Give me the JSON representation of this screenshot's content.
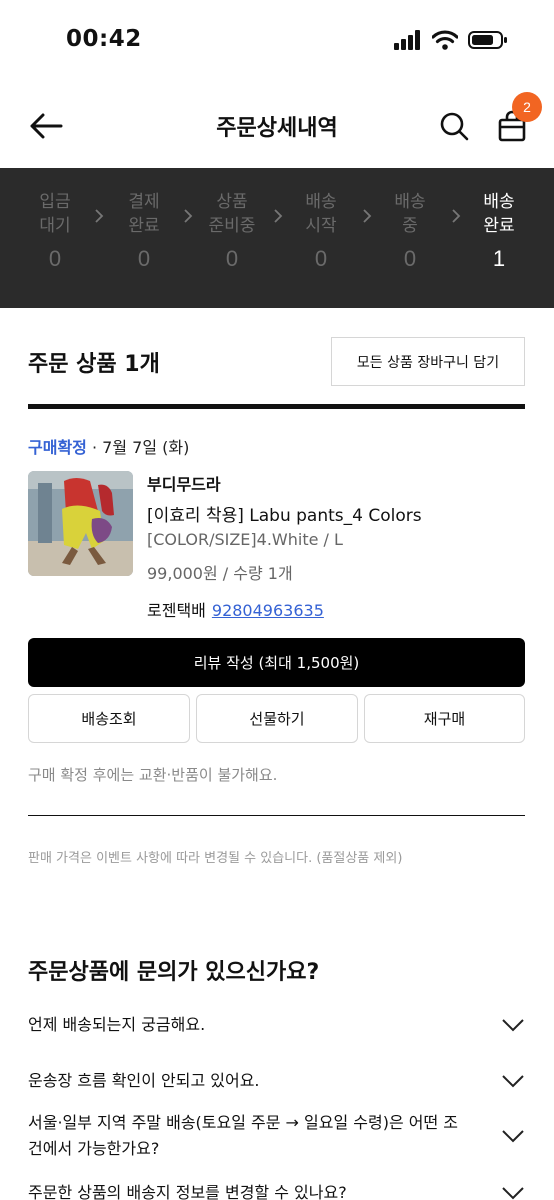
{
  "status_bar": {
    "time": "00:42"
  },
  "header": {
    "title": "주문상세내역",
    "cart_badge": "2"
  },
  "progress": {
    "steps": [
      {
        "label": "입금\n대기",
        "count": "0",
        "active": false
      },
      {
        "label": "결제\n완료",
        "count": "0",
        "active": false
      },
      {
        "label": "상품\n준비중",
        "count": "0",
        "active": false
      },
      {
        "label": "배송\n시작",
        "count": "0",
        "active": false
      },
      {
        "label": "배송\n중",
        "count": "0",
        "active": false
      },
      {
        "label": "배송\n완료",
        "count": "1",
        "active": true
      }
    ]
  },
  "order": {
    "section_title": "주문 상품 1개",
    "cart_all_label": "모든 상품 장바구니 담기",
    "status": "구매확정",
    "date": " · 7월 7일 (화)",
    "product": {
      "brand": "부디무드라",
      "name": "[이효리 착용] Labu pants_4 Colors",
      "option": "[COLOR/SIZE]4.White / L",
      "price_qty": "99,000원 / 수량 1개",
      "courier": "로젠택배",
      "tracking": "92804963635"
    },
    "review_label": "리뷰 작성 (최대 1,500원)",
    "actions": [
      "배송조회",
      "선물하기",
      "재구매"
    ],
    "note_confirm": "구매 확정 후에는 교환·반품이 불가해요.",
    "note_price": "판매 가격은 이벤트 사항에 따라 변경될 수 있습니다. (품절상품 제외)"
  },
  "faq": {
    "title": "주문상품에 문의가 있으신가요?",
    "items": [
      "언제 배송되는지 궁금해요.",
      "운송장 흐름 확인이 안되고 있어요.",
      "서울·일부 지역 주말 배송(토요일 주문 → 일요일 수령)은 어떤 조건에서 가능한가요?",
      "주문한 상품의 배송지 정보를 변경할 수 있나요?"
    ]
  },
  "colors": {
    "accent_blue": "#3562d4",
    "badge_orange": "#f26522",
    "progress_bg": "#2b2b2b"
  }
}
